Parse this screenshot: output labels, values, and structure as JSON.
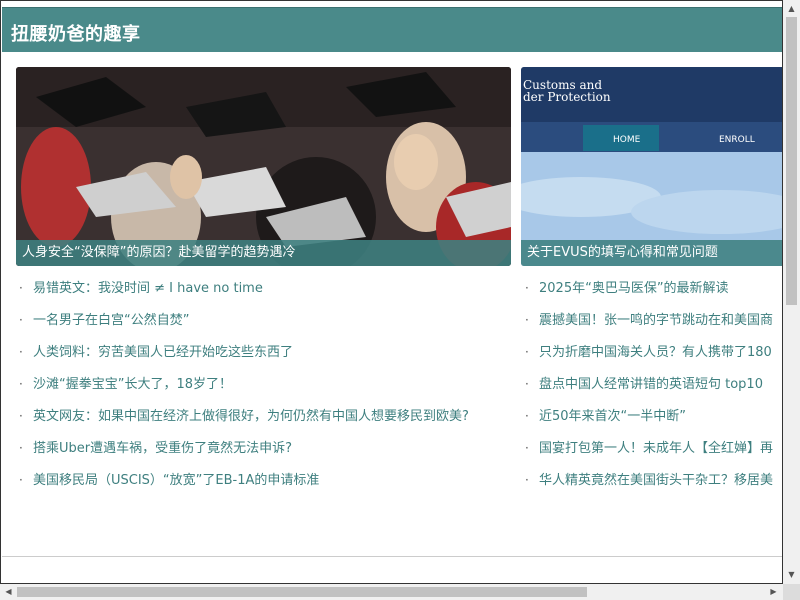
{
  "site": {
    "title": "扭腰奶爸的趣享"
  },
  "featured": [
    {
      "caption": "人身安全“没保障”的原因？赴美留学的趋势遇冷",
      "image": "graduation-crowd-photo"
    },
    {
      "caption": "关于EVUS的填写心得和常见问题",
      "image": "cbp-website-screenshot",
      "image_text": {
        "line1": "Customs and",
        "line2": "der Protection",
        "home": "HOME",
        "enroll": "ENROLL"
      }
    }
  ],
  "articles_left": [
    "易错英文：我没时间 ≠ I have no time",
    "一名男子在白宫“公然自焚”",
    "人类饲料：穷苦美国人已经开始吃这些东西了",
    "沙滩“握拳宝宝”长大了，18岁了！",
    "英文网友：如果中国在经济上做得很好，为何仍然有中国人想要移民到欧美?",
    "搭乘Uber遭遇车祸，受重伤了竟然无法申诉?",
    "美国移民局（USCIS）“放宽”了EB-1A的申请标准"
  ],
  "articles_right": [
    "2025年“奥巴马医保”的最新解读",
    "震撼美国！张一鸣的字节跳动在和美国商",
    "只为折磨中国海关人员？有人携带了180",
    "盘点中国人经常讲错的英语短句 top10",
    "近50年来首次“一半中断”",
    "国宴打包第一人！未成年人【全红婵】再",
    "华人精英竟然在美国街头干杂工？移居美"
  ],
  "bullet": "·",
  "icons": {
    "scroll_up": "scroll-up-arrow-icon",
    "scroll_down": "scroll-down-arrow-icon",
    "scroll_left": "scroll-left-arrow-icon",
    "scroll_right": "scroll-right-arrow-icon"
  },
  "colors": {
    "accent": "#4a8a8a",
    "link": "#3e7f7f",
    "caption_bg": "#3e8080"
  }
}
